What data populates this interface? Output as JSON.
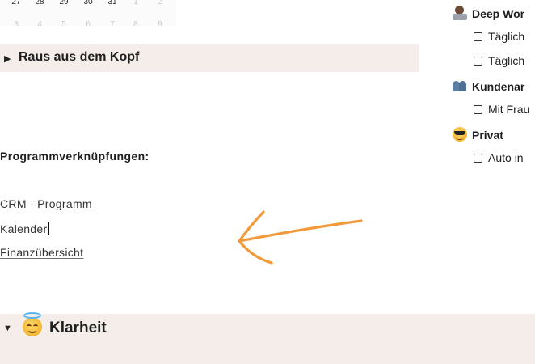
{
  "calendar": {
    "row1": [
      "27",
      "28",
      "29",
      "30",
      "31",
      "1",
      "2"
    ],
    "row2": [
      "3",
      "4",
      "5",
      "6",
      "7",
      "8",
      "9"
    ]
  },
  "section1": {
    "title": "Raus aus dem Kopf",
    "expanded": false
  },
  "shortcuts": {
    "heading": "Programmverknüpfungen:",
    "links": [
      "CRM - Programm",
      "Kalender",
      "Finanzübersicht"
    ]
  },
  "section2": {
    "title": "Klarheit",
    "expanded": true,
    "emoji": "smiling-face-with-halo-icon"
  },
  "right_column": {
    "groups": [
      {
        "title": "Deep Wor",
        "icon": "technologist-icon",
        "items": [
          "Täglich",
          "Täglich"
        ]
      },
      {
        "title": "Kundenar",
        "icon": "people-icon",
        "items": [
          "Mit Frau"
        ]
      },
      {
        "title": "Privat",
        "icon": "sunglasses-face-icon",
        "items": [
          "Auto in"
        ]
      }
    ]
  },
  "colors": {
    "toggle_background": "#f4ede9",
    "arrow": "#f29a3a"
  }
}
